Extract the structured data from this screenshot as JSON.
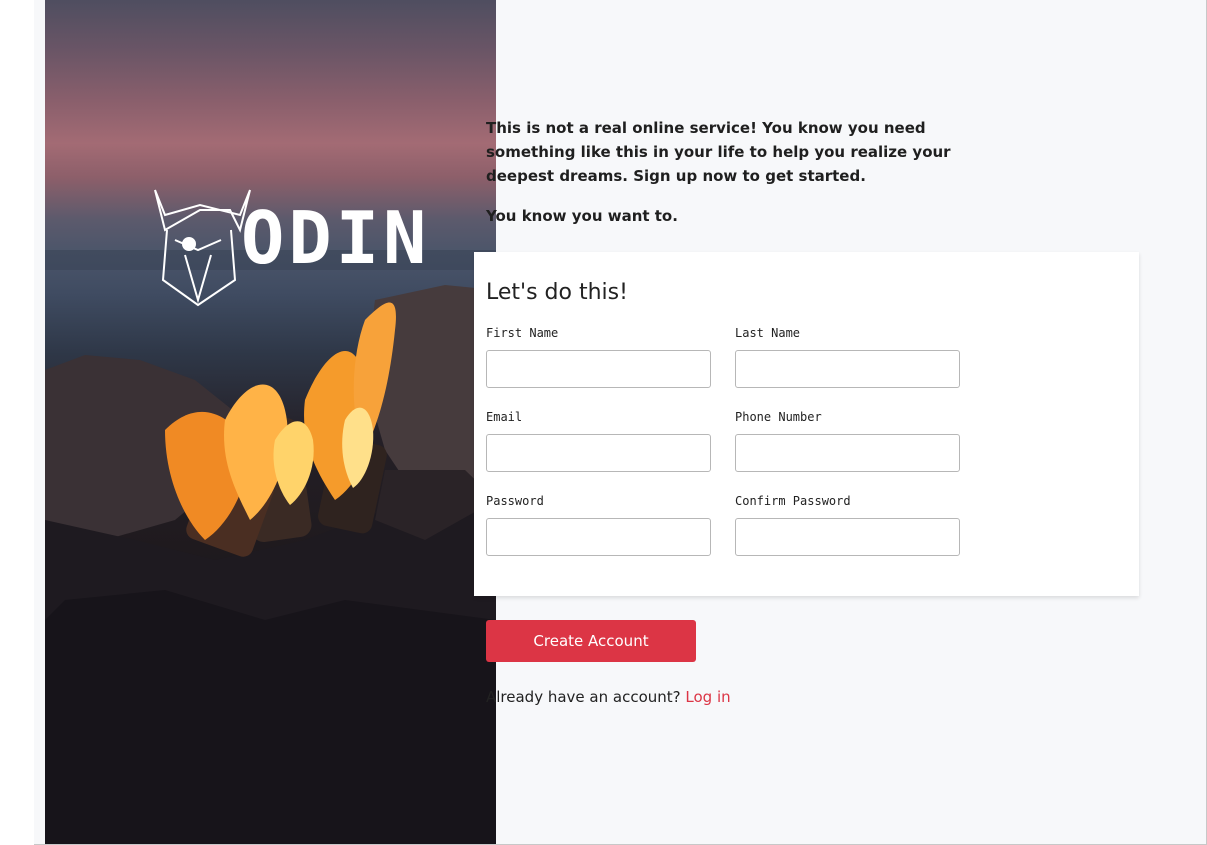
{
  "brand": {
    "logo_text": "ODIN"
  },
  "intro": {
    "paragraph1": "This is not a real online service! You know you need something like this in your life to help you realize your deepest dreams. Sign up now to get started.",
    "paragraph2": "You know you want to."
  },
  "form": {
    "heading": "Let's do this!",
    "fields": [
      {
        "label": "First Name",
        "value": ""
      },
      {
        "label": "Last Name",
        "value": ""
      },
      {
        "label": "Email",
        "value": ""
      },
      {
        "label": "Phone Number",
        "value": ""
      },
      {
        "label": "Password",
        "value": ""
      },
      {
        "label": "Confirm Password",
        "value": ""
      }
    ]
  },
  "actions": {
    "create_account_label": "Create Account",
    "login_prompt": "Already have an account?",
    "login_link": "Log in"
  },
  "colors": {
    "accent": "#dc3545",
    "panel_bg": "#f7f8fa",
    "card_bg": "#ffffff"
  }
}
